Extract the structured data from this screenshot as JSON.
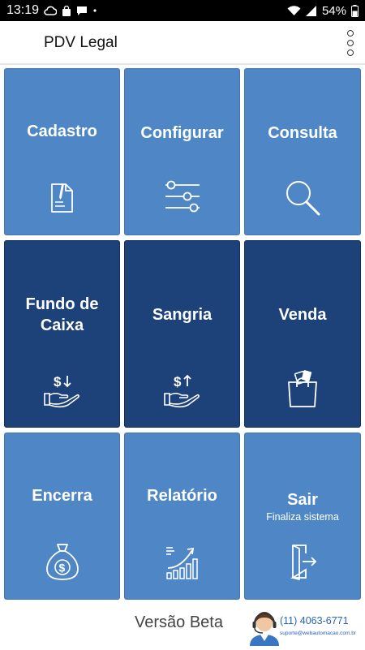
{
  "status_bar": {
    "time": "13:19",
    "battery": "54%",
    "icons_left": [
      "cloud-icon",
      "bag-icon",
      "chat-icon",
      "dot"
    ],
    "icons_right": [
      "wifi-icon",
      "signal-icon",
      "battery-icon"
    ]
  },
  "app_bar": {
    "title": "PDV Legal",
    "menu_icon": "more-vert-icon"
  },
  "colors": {
    "tile_light": "#4f86c6",
    "tile_dark": "#1d4179",
    "status_bar": "#000000",
    "support_text": "#2a63b6"
  },
  "tiles": [
    {
      "label": "Cadastro",
      "icon": "document-pen-icon",
      "style": "light"
    },
    {
      "label": "Configurar",
      "icon": "sliders-icon",
      "style": "light"
    },
    {
      "label": "Consulta",
      "icon": "magnifier-icon",
      "style": "light"
    },
    {
      "label": "Fundo de Caixa",
      "label_line1": "Fundo de",
      "label_line2": "Caixa",
      "icon": "hand-dollar-down-icon",
      "style": "dark"
    },
    {
      "label": "Sangria",
      "icon": "hand-dollar-up-icon",
      "style": "dark"
    },
    {
      "label": "Venda",
      "icon": "shopping-bag-icon",
      "style": "dark"
    },
    {
      "label": "Encerra",
      "icon": "money-bag-icon",
      "style": "light"
    },
    {
      "label": "Relatório",
      "icon": "bar-chart-growth-icon",
      "style": "light"
    },
    {
      "label": "Sair",
      "sublabel": "Finaliza sistema",
      "icon": "exit-door-icon",
      "style": "light"
    }
  ],
  "footer": {
    "version": "Versão Beta",
    "support_phone": "(11) 4063-6771",
    "support_email": "suporte@webautomacao.com.br",
    "support_icon": "support-agent-icon"
  }
}
